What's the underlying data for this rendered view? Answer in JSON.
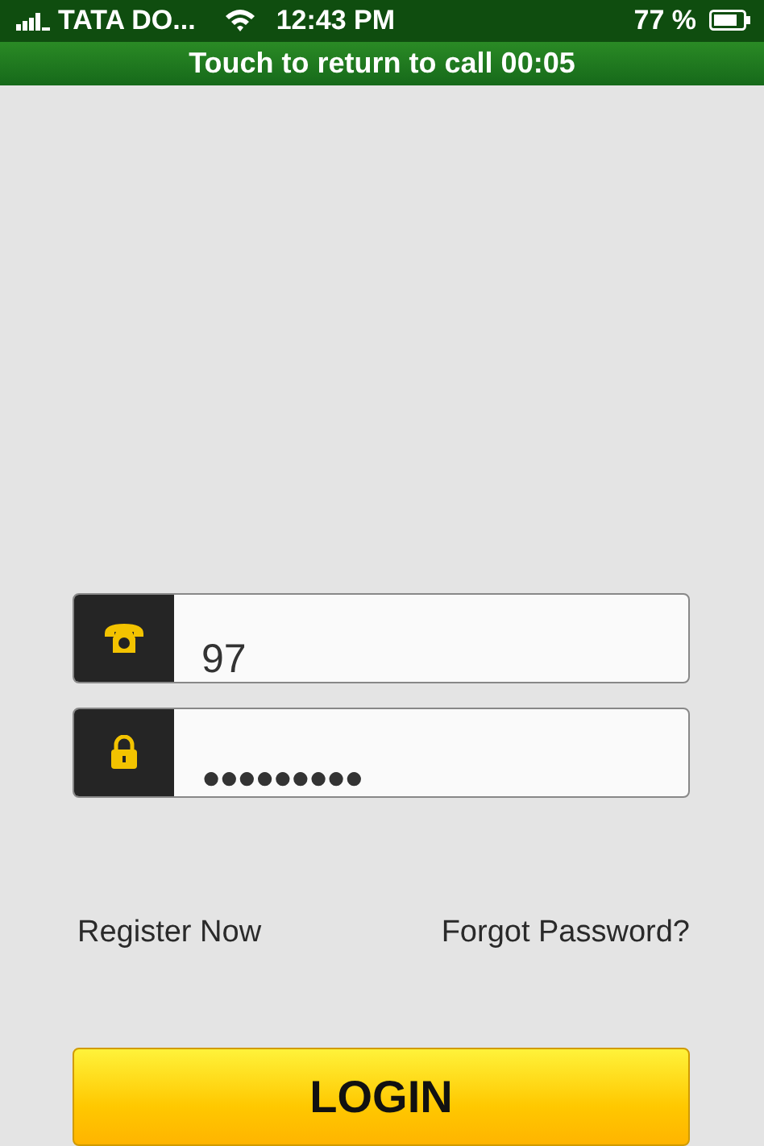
{
  "status_bar": {
    "carrier": "TATA DO...",
    "time": "12:43 PM",
    "battery": "77 %"
  },
  "call_banner": {
    "text": "Touch to return to call  00:05"
  },
  "fields": [
    {
      "kind": "phone",
      "value": "97"
    },
    {
      "kind": "password",
      "value": "●●●●●●●●●"
    }
  ],
  "links": [
    "Register Now",
    "Forgot Password?"
  ],
  "login_button": {
    "label": "LOGIN"
  }
}
